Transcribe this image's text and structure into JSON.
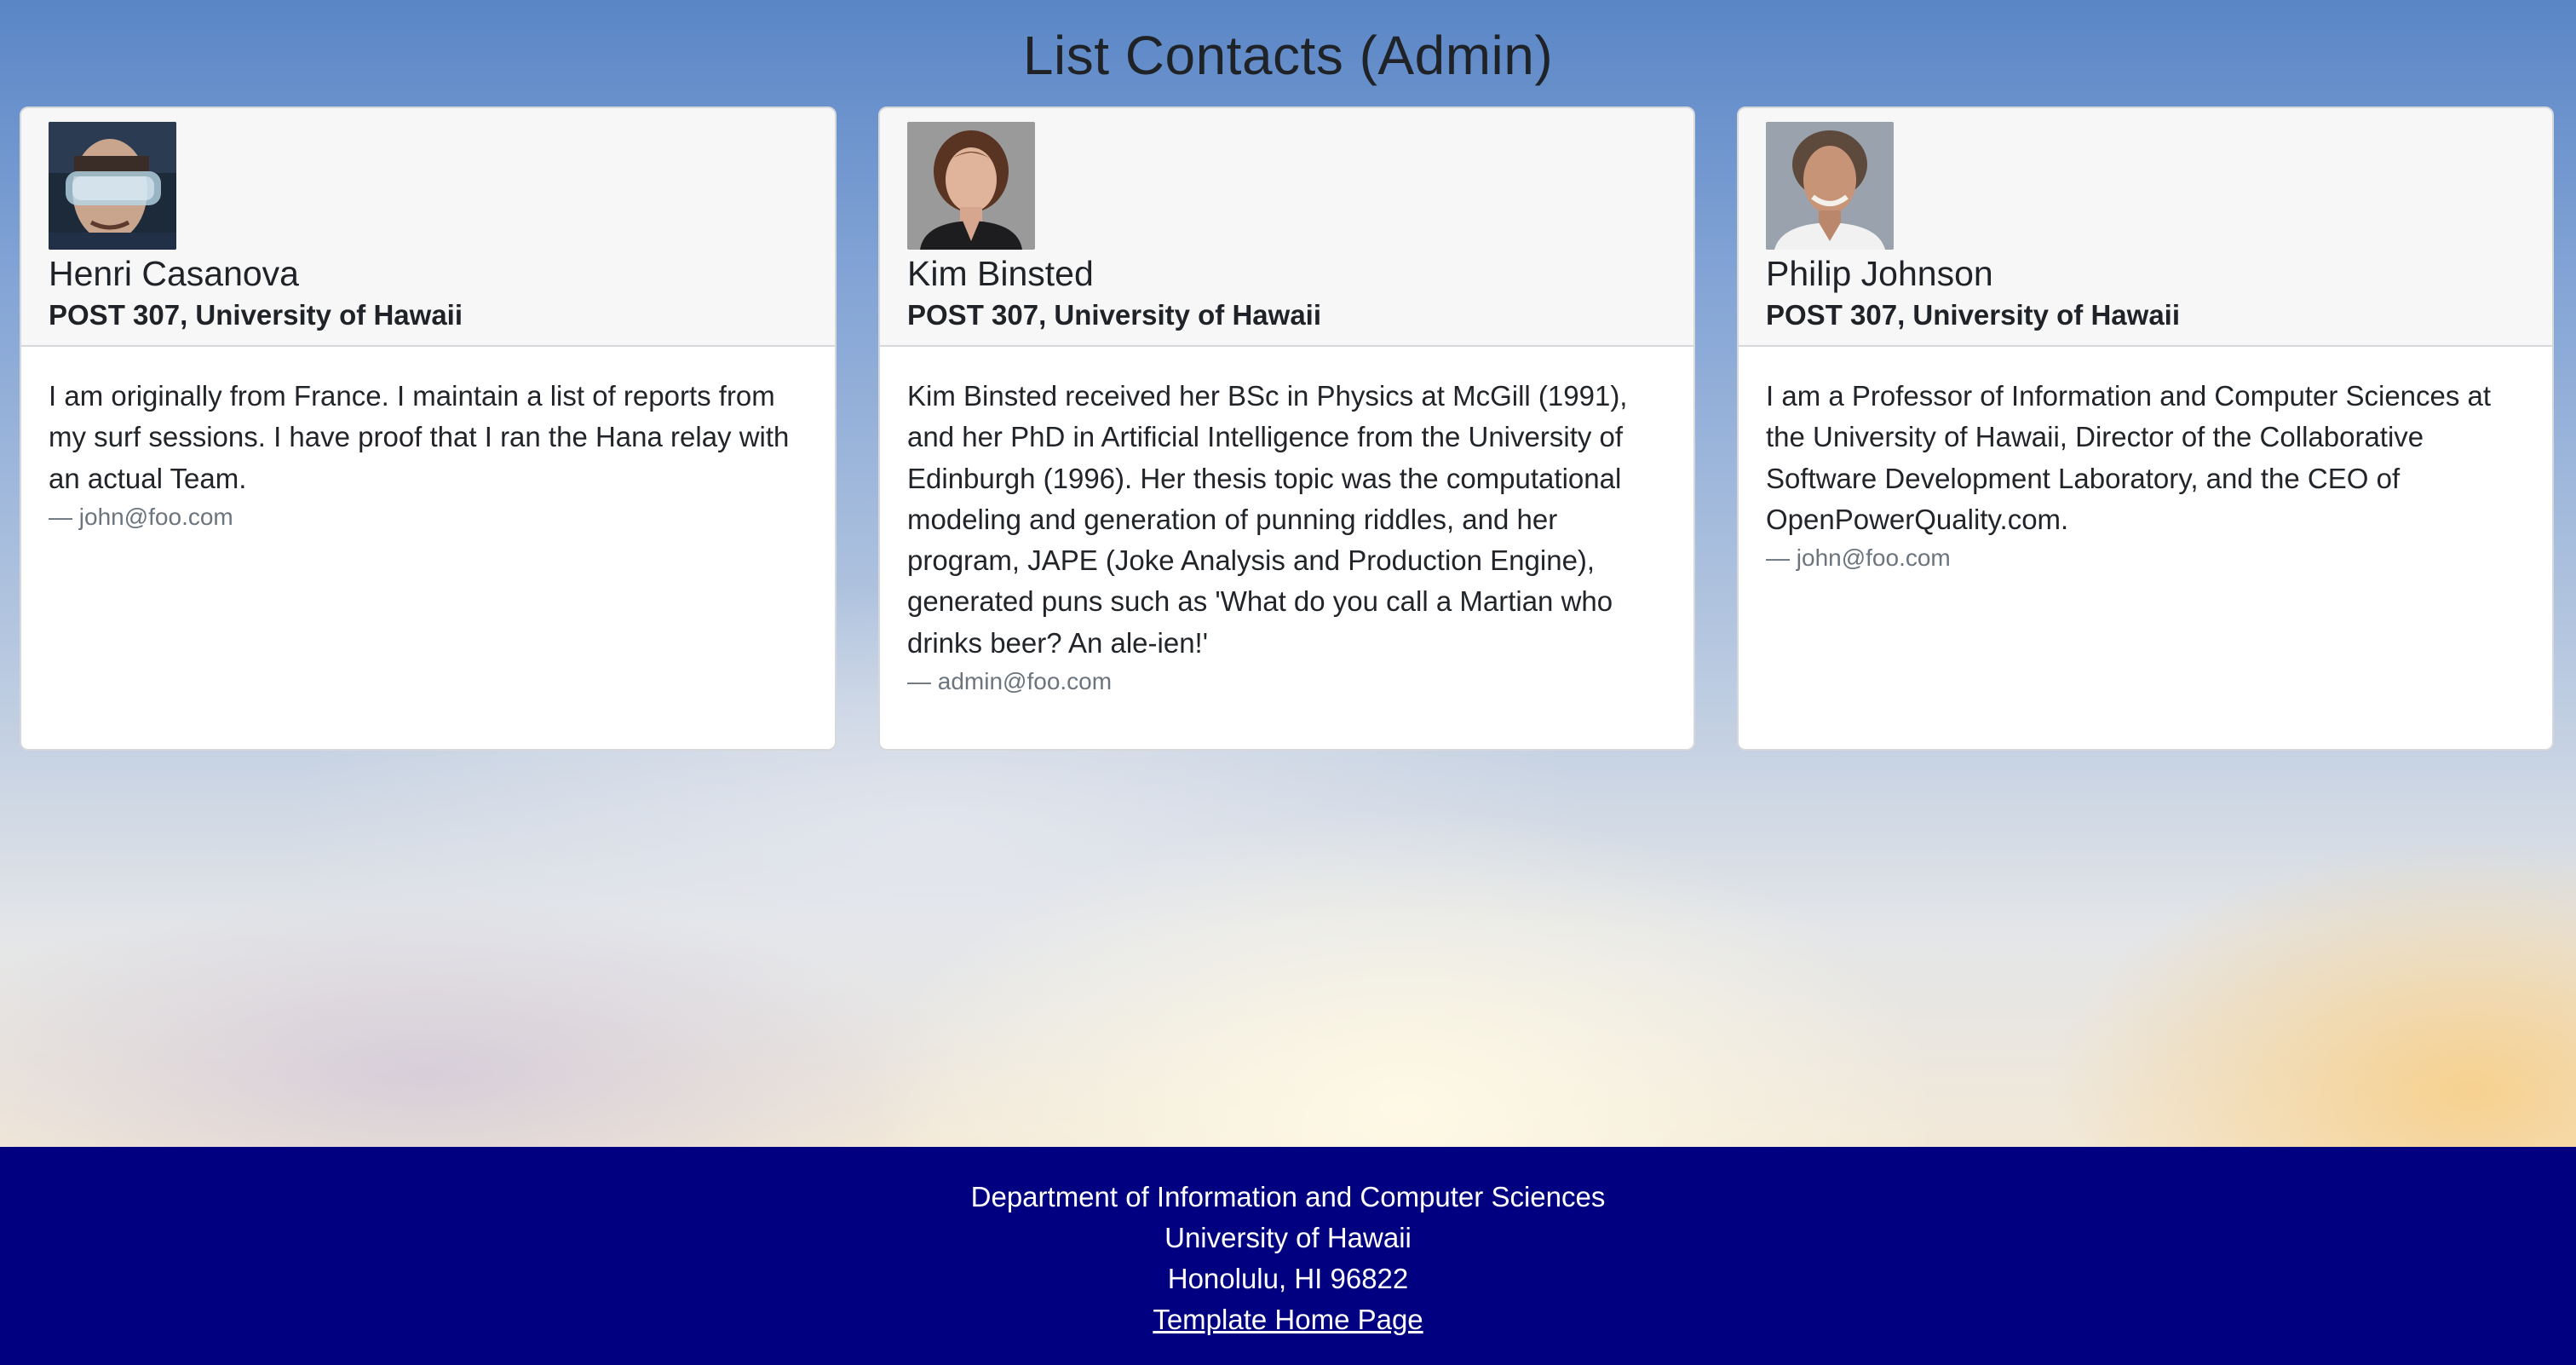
{
  "page": {
    "title": "List Contacts (Admin)"
  },
  "contacts": [
    {
      "name": "Henri Casanova",
      "address": "POST 307, University of Hawaii",
      "description": "I am originally from France. I maintain a list of reports from my surf sessions. I have proof that I ran the Hana relay with an actual Team.",
      "email": "— john@foo.com",
      "image_icon": "person-goggles-avatar"
    },
    {
      "name": "Kim Binsted",
      "address": "POST 307, University of Hawaii",
      "description": "Kim Binsted received her BSc in Physics at McGill (1991), and her PhD in Artificial Intelligence from the University of Edinburgh (1996). Her thesis topic was the computational modeling and generation of punning riddles, and her program, JAPE (Joke Analysis and Production Engine), generated puns such as 'What do you call a Martian who drinks beer? An ale-ien!'",
      "email": "— admin@foo.com",
      "image_icon": "woman-portrait-avatar"
    },
    {
      "name": "Philip Johnson",
      "address": "POST 307, University of Hawaii",
      "description": "I am a Professor of Information and Computer Sciences at the University of Hawaii, Director of the Collaborative Software Development Laboratory, and the CEO of OpenPowerQuality.com.",
      "email": "— john@foo.com",
      "image_icon": "man-portrait-avatar"
    }
  ],
  "footer": {
    "line1": "Department of Information and Computer Sciences",
    "line2": "University of Hawaii",
    "line3": "Honolulu, HI 96822",
    "link": "Template Home Page"
  },
  "colors": {
    "footer_bg": "#000080",
    "card_header_bg": "#f7f7f7",
    "email_text": "#6c757d"
  }
}
